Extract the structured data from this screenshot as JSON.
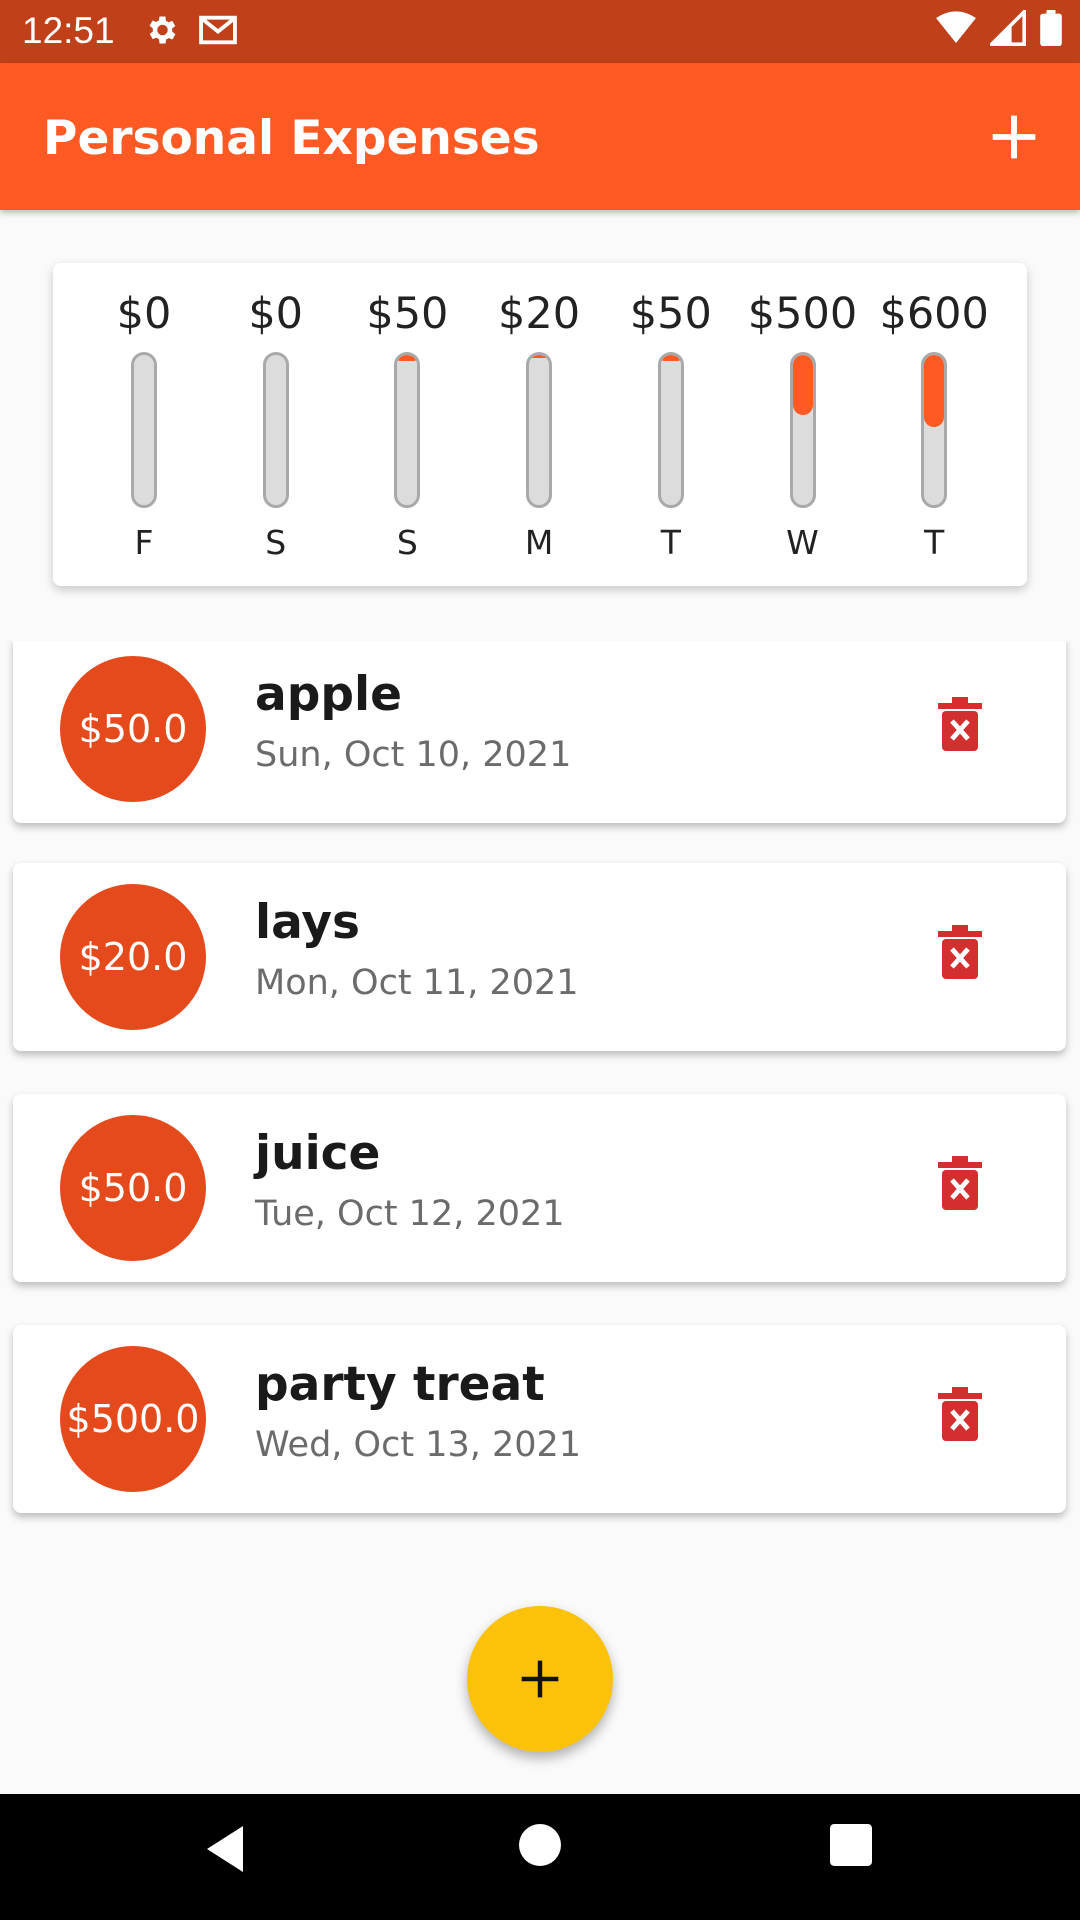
{
  "status_bar": {
    "time": "12:51",
    "left_icons": [
      "gear-icon",
      "gmail-icon"
    ],
    "right_icons": [
      "wifi-icon",
      "signal-icon",
      "battery-icon"
    ],
    "background": "#bf4019"
  },
  "app_bar": {
    "title": "Personal Expenses",
    "action_icon": "plus-icon",
    "background": "#ff5a23"
  },
  "chart_data": {
    "type": "bar",
    "categories": [
      "F",
      "S",
      "S",
      "M",
      "T",
      "W",
      "T"
    ],
    "amount_labels": [
      "$0",
      "$0",
      "$50",
      "$20",
      "$50",
      "$500",
      "$600"
    ],
    "values": [
      0,
      0,
      50,
      20,
      50,
      500,
      600
    ],
    "fill_fraction": [
      0,
      0,
      0.04,
      0.02,
      0.04,
      0.4,
      0.48
    ],
    "fill_color": "#ff5a23",
    "track_color": "#dcdcdc"
  },
  "transactions": [
    {
      "amount": "$50.0",
      "title": "apple",
      "date": "Sun, Oct 10, 2021"
    },
    {
      "amount": "$20.0",
      "title": "lays",
      "date": "Mon, Oct 11, 2021"
    },
    {
      "amount": "$50.0",
      "title": "juice",
      "date": "Tue, Oct 12, 2021"
    },
    {
      "amount": "$500.0",
      "title": "party treat",
      "date": "Wed, Oct 13, 2021"
    }
  ],
  "colors": {
    "avatar": "#e44a1c",
    "delete_icon": "#d32f2f",
    "fab": "#fcc109"
  },
  "fab": {
    "icon": "plus-icon"
  },
  "nav_bar": {
    "buttons": [
      "back-icon",
      "home-icon",
      "recents-icon"
    ]
  }
}
